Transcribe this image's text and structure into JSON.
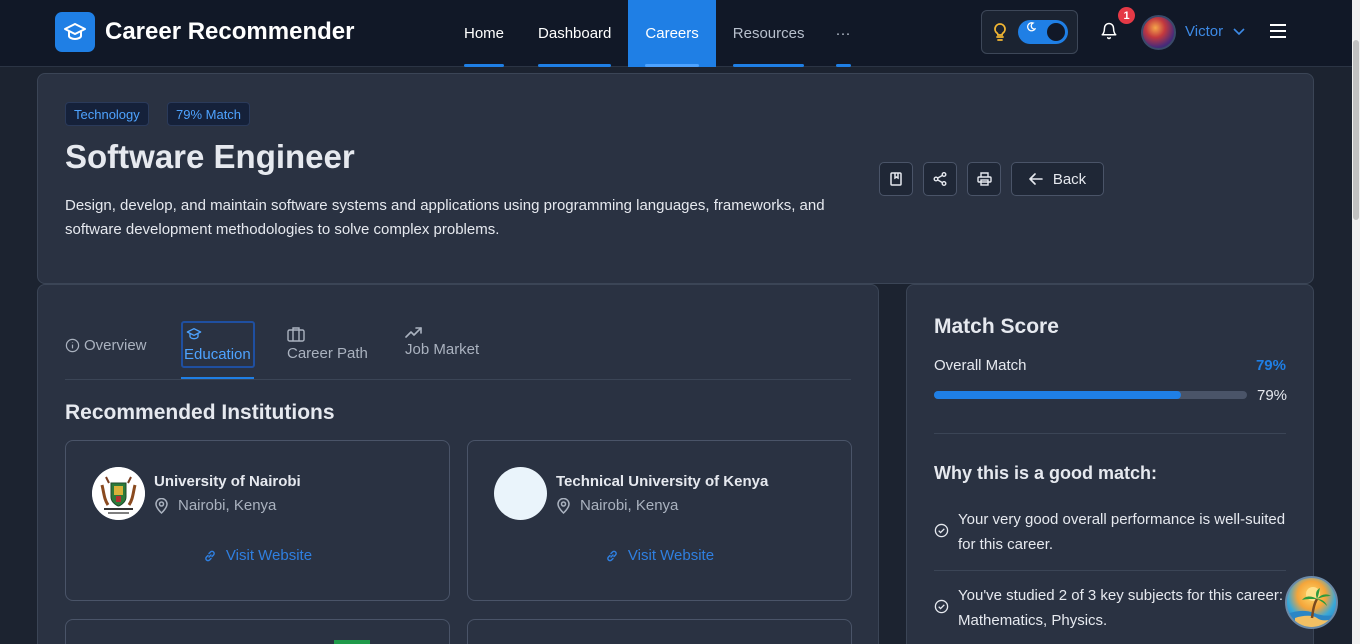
{
  "app": {
    "title": "Career Recommender"
  },
  "nav": {
    "items": [
      {
        "label": "Home",
        "active": false
      },
      {
        "label": "Dashboard",
        "active": false
      },
      {
        "label": "Careers",
        "active": true
      },
      {
        "label": "Resources",
        "active": false
      },
      {
        "label": "···",
        "active": false
      }
    ]
  },
  "user": {
    "name": "Victor",
    "notifications": "1"
  },
  "career": {
    "category": "Technology",
    "match_badge": "79% Match",
    "title": "Software Engineer",
    "description": "Design, develop, and maintain software systems and applications using programming languages, frameworks, and software development methodologies to solve complex problems.",
    "back_label": "Back"
  },
  "tabs": {
    "overview": "Overview",
    "education": "Education",
    "career_path": "Career Path",
    "job_market": "Job Market"
  },
  "institutions": {
    "section_title": "Recommended Institutions",
    "items": [
      {
        "name": "University of Nairobi",
        "location": "Nairobi, Kenya",
        "link_label": "Visit Website"
      },
      {
        "name": "Technical University of Kenya",
        "location": "Nairobi, Kenya",
        "link_label": "Visit Website"
      }
    ]
  },
  "match": {
    "title": "Match Score",
    "overall_label": "Overall Match",
    "overall_value": "79%",
    "progress_fraction": 0.79,
    "progress_text": "79%",
    "why_title": "Why this is a good match:",
    "reasons": [
      "Your very good overall performance is well-suited for this career.",
      "You've studied 2 of 3 key subjects for this career: Mathematics, Physics."
    ]
  },
  "colors": {
    "accent": "#1f7fe5",
    "background": "#1c2330",
    "card": "#2a3242",
    "navbar": "#111827"
  }
}
